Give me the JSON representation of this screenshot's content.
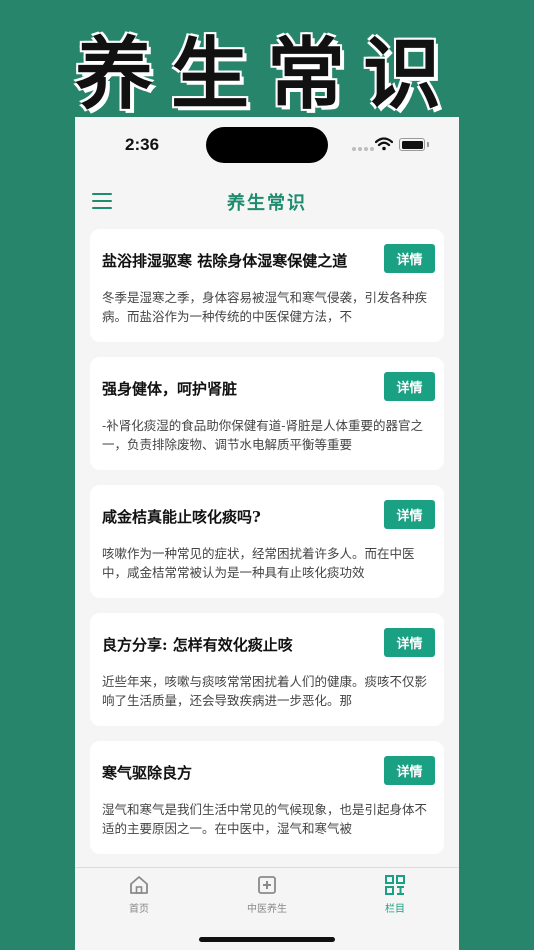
{
  "banner": {
    "title": "养生常识"
  },
  "status_bar": {
    "time": "2:36"
  },
  "navbar": {
    "title": "养生常识",
    "menu_icon": "menu-icon"
  },
  "articles": [
    {
      "title": "盐浴排湿驱寒 祛除身体湿寒保健之道",
      "button": "详情",
      "excerpt": "冬季是湿寒之季，身体容易被湿气和寒气侵袭，引发各种疾病。而盐浴作为一种传统的中医保健方法，不"
    },
    {
      "title": "强身健体，呵护肾脏",
      "button": "详情",
      "excerpt": "-补肾化痰湿的食品助你保健有道-肾脏是人体重要的器官之一，负责排除废物、调节水电解质平衡等重要"
    },
    {
      "title": "咸金桔真能止咳化痰吗?",
      "button": "详情",
      "excerpt": "咳嗽作为一种常见的症状，经常困扰着许多人。而在中医中，咸金桔常常被认为是一种具有止咳化痰功效"
    },
    {
      "title": "良方分享: 怎样有效化痰止咳",
      "button": "详情",
      "excerpt": "近些年来，咳嗽与痰咳常常困扰着人们的健康。痰咳不仅影响了生活质量，还会导致疾病进一步恶化。那"
    },
    {
      "title": "寒气驱除良方",
      "button": "详情",
      "excerpt": "湿气和寒气是我们生活中常见的气候现象，也是引起身体不适的主要原因之一。在中医中，湿气和寒气被"
    }
  ],
  "tabs": [
    {
      "label": "首页",
      "icon": "home-icon",
      "active": false
    },
    {
      "label": "中医养生",
      "icon": "plus-box-icon",
      "active": false
    },
    {
      "label": "栏目",
      "icon": "grid-icon",
      "active": true
    }
  ],
  "colors": {
    "accent": "#1aa082",
    "background": "#26856a",
    "tab_inactive": "#8a8a8a"
  }
}
